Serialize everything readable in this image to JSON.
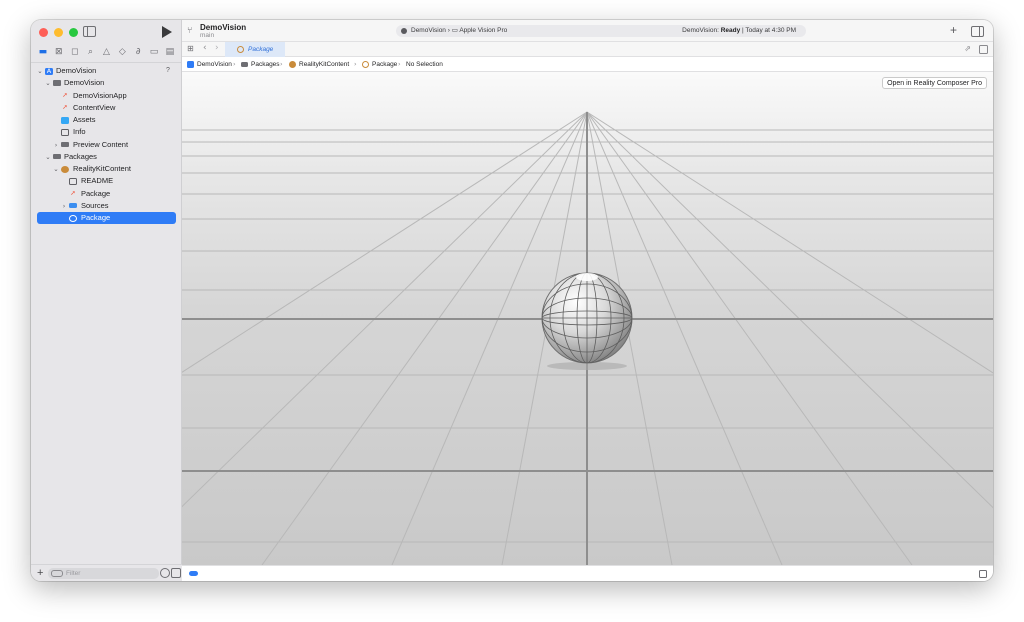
{
  "window": {
    "project_name": "DemoVision",
    "branch": "main"
  },
  "toolbar": {
    "scheme": "DemoVision",
    "destination": "Apple Vision Pro",
    "status_prefix": "DemoVision:",
    "status_state": "Ready",
    "status_time": "| Today at 4:30 PM"
  },
  "sidebar": {
    "root_badge": "?",
    "items": [
      {
        "label": "DemoVision",
        "icon": "app-icon"
      },
      {
        "label": "DemoVision",
        "icon": "folder-icon"
      },
      {
        "label": "DemoVisionApp",
        "icon": "swift-file-icon"
      },
      {
        "label": "ContentView",
        "icon": "swift-file-icon"
      },
      {
        "label": "Assets",
        "icon": "asset-catalog-icon"
      },
      {
        "label": "Info",
        "icon": "plist-icon"
      },
      {
        "label": "Preview Content",
        "icon": "folder-icon"
      },
      {
        "label": "Packages",
        "icon": "folder-icon"
      },
      {
        "label": "RealityKitContent",
        "icon": "package-icon"
      },
      {
        "label": "README",
        "icon": "book-icon"
      },
      {
        "label": "Package",
        "icon": "swift-file-icon"
      },
      {
        "label": "Sources",
        "icon": "folder-icon"
      },
      {
        "label": "Package",
        "icon": "package-icon"
      }
    ],
    "filter_placeholder": "Filter"
  },
  "tabs": {
    "active_label": "Package"
  },
  "breadcrumb": {
    "items": [
      "DemoVision",
      "Packages",
      "RealityKitContent",
      "Package",
      "No Selection"
    ]
  },
  "viewport": {
    "open_button_label": "Open in Reality Composer Pro"
  },
  "colors": {
    "accent": "#2f7cf6",
    "sidebar_bg": "#e7e6e9",
    "viewport_floor": "#d0d0d0"
  }
}
